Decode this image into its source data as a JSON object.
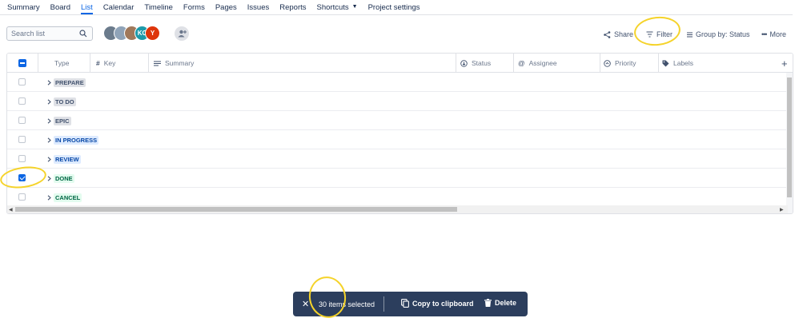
{
  "nav": {
    "tabs": [
      {
        "label": "Summary"
      },
      {
        "label": "Board"
      },
      {
        "label": "List",
        "active": true
      },
      {
        "label": "Calendar"
      },
      {
        "label": "Timeline"
      },
      {
        "label": "Forms"
      },
      {
        "label": "Pages"
      },
      {
        "label": "Issues"
      },
      {
        "label": "Reports"
      },
      {
        "label": "Shortcuts"
      },
      {
        "label": "Project settings"
      }
    ]
  },
  "toolbar": {
    "search_placeholder": "Search list",
    "avatars": [
      "",
      "",
      "",
      "KC",
      "Y"
    ],
    "share_label": "Share",
    "filter_label": "Filter",
    "groupby_label": "Group by: Status",
    "more_label": "More"
  },
  "table": {
    "columns": {
      "type": "Type",
      "key": "Key",
      "summary": "Summary",
      "status": "Status",
      "assignee": "Assignee",
      "priority": "Priority",
      "labels": "Labels"
    },
    "groups": [
      {
        "label": "PREPARE",
        "tone": "grey",
        "checked": false
      },
      {
        "label": "TO DO",
        "tone": "grey",
        "checked": false
      },
      {
        "label": "EPIC",
        "tone": "grey",
        "checked": false
      },
      {
        "label": "IN PROGRESS",
        "tone": "blue",
        "checked": false
      },
      {
        "label": "REVIEW",
        "tone": "blue",
        "checked": false
      },
      {
        "label": "DONE",
        "tone": "green",
        "checked": true
      },
      {
        "label": "CANCEL",
        "tone": "green",
        "checked": false
      }
    ]
  },
  "selection_bar": {
    "count_text": "30 items selected",
    "copy_label": "Copy to clipboard",
    "delete_label": "Delete"
  },
  "colors": {
    "accent": "#0c66e4",
    "selection_bar_bg": "#2c3e5d",
    "annotation": "#f5d32a"
  }
}
